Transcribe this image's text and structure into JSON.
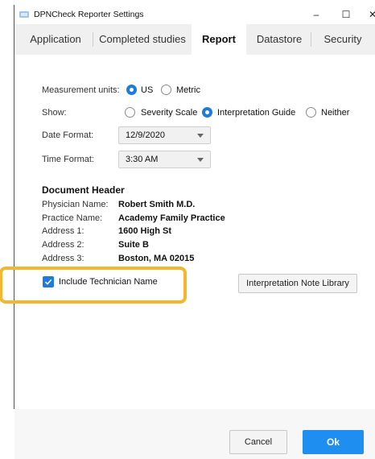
{
  "window": {
    "title": "DPNCheck Reporter Settings",
    "controls": {
      "minimize": "–",
      "maximize": "☐",
      "close": "✕"
    }
  },
  "tabs": [
    {
      "label": "Application",
      "active": false
    },
    {
      "label": "Completed studies",
      "active": false
    },
    {
      "label": "Report",
      "active": true
    },
    {
      "label": "Datastore",
      "active": false
    },
    {
      "label": "Security",
      "active": false
    }
  ],
  "measurement": {
    "label": "Measurement units:",
    "options": [
      {
        "label": "US",
        "selected": true
      },
      {
        "label": "Metric",
        "selected": false
      }
    ]
  },
  "show": {
    "label": "Show:",
    "options": [
      {
        "label": "Severity Scale",
        "selected": false
      },
      {
        "label": "Interpretation Guide",
        "selected": true
      },
      {
        "label": "Neither",
        "selected": false
      }
    ]
  },
  "date_format": {
    "label": "Date Format:",
    "value": "12/9/2020"
  },
  "time_format": {
    "label": "Time Format:",
    "value": "3:30 AM"
  },
  "document_header": {
    "title": "Document Header",
    "rows": [
      {
        "label": "Physician Name:",
        "value": "Robert Smith M.D."
      },
      {
        "label": "Practice Name:",
        "value": "Academy Family Practice"
      },
      {
        "label": "Address 1:",
        "value": "1600 High St"
      },
      {
        "label": "Address 2:",
        "value": "Suite B"
      },
      {
        "label": "Address 3:",
        "value": "Boston, MA 02015"
      }
    ]
  },
  "include_technician": {
    "label": "Include Technician Name",
    "checked": true
  },
  "buttons": {
    "note_library": "Interpretation Note Library",
    "cancel": "Cancel",
    "ok": "Ok"
  },
  "colors": {
    "accent": "#1e7bdc",
    "highlight": "#f5b52e",
    "ok_button": "#1e8ef0"
  }
}
